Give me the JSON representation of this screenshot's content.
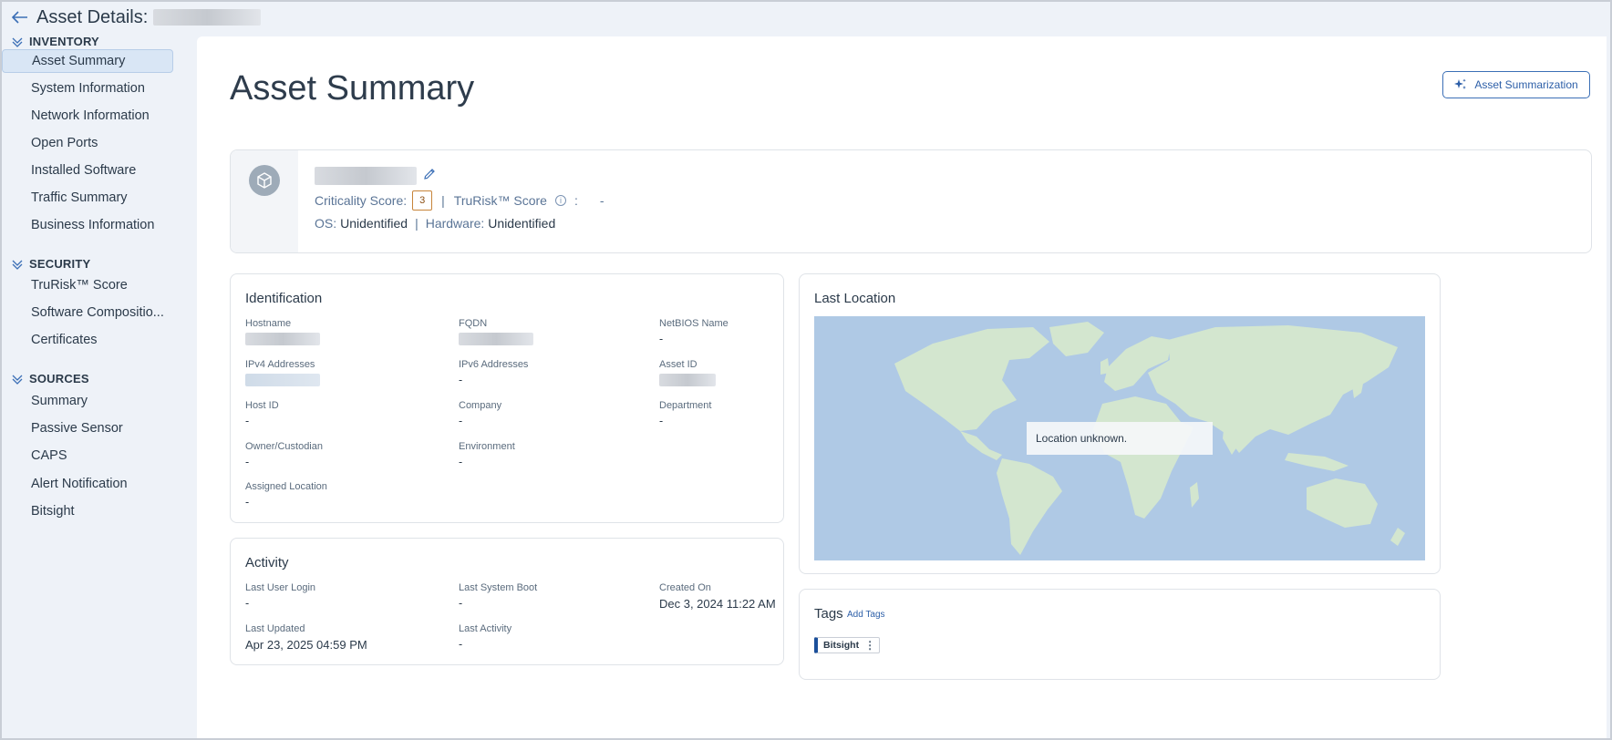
{
  "header": {
    "title": "Asset Details:"
  },
  "sidebar": {
    "sections": [
      {
        "title": "INVENTORY",
        "items": [
          "Asset Summary",
          "System Information",
          "Network Information",
          "Open Ports",
          "Installed Software",
          "Traffic Summary",
          "Business Information"
        ]
      },
      {
        "title": "SECURITY",
        "items": [
          "TruRisk™ Score",
          "Software Compositio...",
          "Certificates"
        ]
      },
      {
        "title": "SOURCES",
        "items": [
          "Summary",
          "Passive Sensor",
          "CAPS",
          "Alert Notification",
          "Bitsight"
        ]
      }
    ],
    "active": "Asset Summary"
  },
  "main": {
    "title": "Asset Summary",
    "summarize_button": "Asset Summarization",
    "asset": {
      "criticality_label": "Criticality Score:",
      "criticality_value": "3",
      "trurisk_label": "TruRisk™ Score",
      "trurisk_colon": ":",
      "trurisk_value": "-",
      "separator": "|",
      "os_label": "OS:",
      "os_value": "Unidentified",
      "hardware_label": "Hardware:",
      "hardware_value": "Unidentified"
    },
    "identification": {
      "title": "Identification",
      "fields": {
        "hostname": {
          "label": "Hostname",
          "value": ""
        },
        "fqdn": {
          "label": "FQDN",
          "value": ""
        },
        "netbios": {
          "label": "NetBIOS Name",
          "value": "-"
        },
        "ipv4": {
          "label": "IPv4 Addresses",
          "value": ""
        },
        "ipv6": {
          "label": "IPv6 Addresses",
          "value": "-"
        },
        "asset_id": {
          "label": "Asset ID",
          "value": ""
        },
        "host_id": {
          "label": "Host ID",
          "value": "-"
        },
        "company": {
          "label": "Company",
          "value": "-"
        },
        "department": {
          "label": "Department",
          "value": "-"
        },
        "owner": {
          "label": "Owner/Custodian",
          "value": "-"
        },
        "environment": {
          "label": "Environment",
          "value": "-"
        },
        "assigned_location": {
          "label": "Assigned Location",
          "value": "-"
        }
      }
    },
    "activity": {
      "title": "Activity",
      "fields": {
        "last_user_login": {
          "label": "Last User Login",
          "value": "-"
        },
        "last_system_boot": {
          "label": "Last System Boot",
          "value": "-"
        },
        "created_on": {
          "label": "Created On",
          "value": "Dec 3, 2024 11:22 AM"
        },
        "last_updated": {
          "label": "Last Updated",
          "value": "Apr 23, 2025 04:59 PM"
        },
        "last_activity": {
          "label": "Last Activity",
          "value": "-"
        }
      }
    },
    "location": {
      "title": "Last Location",
      "message": "Location unknown."
    },
    "tags": {
      "title": "Tags",
      "add_label": "Add Tags",
      "items": [
        "Bitsight"
      ]
    }
  },
  "colors": {
    "accent": "#3b6fb6",
    "map_water": "#afc9e5",
    "map_land": "#d3e6cf",
    "criticality_border": "#c7843a"
  }
}
